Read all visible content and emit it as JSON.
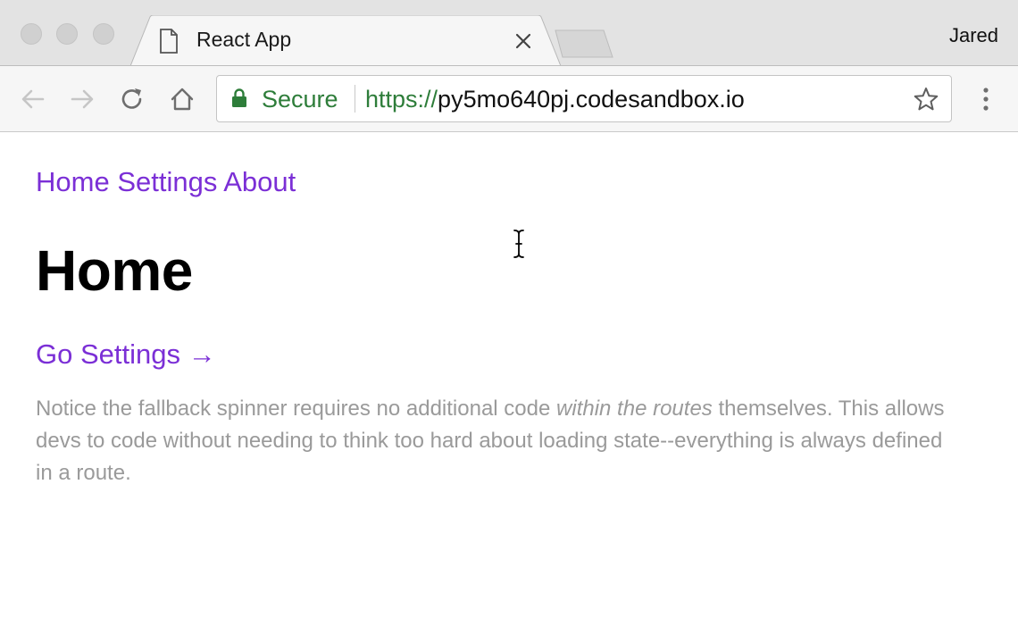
{
  "browser": {
    "tab": {
      "title": "React App"
    },
    "profile_name": "Jared",
    "address_bar": {
      "secure_label": "Secure",
      "url_scheme": "https://",
      "url_host": "py5mo640pj.codesandbox.io"
    },
    "colors": {
      "secure_green": "#2e7d3a",
      "tabstrip": "#e3e3e3"
    }
  },
  "page": {
    "nav": [
      {
        "label": "Home"
      },
      {
        "label": "Settings"
      },
      {
        "label": "About"
      }
    ],
    "heading": "Home",
    "go_link": "Go Settings →",
    "notice": {
      "before": "Notice the fallback spinner requires no additional code ",
      "emphasis": "within the routes",
      "after": " themselves. This allows devs to code without needing to think too hard about loading state--everything is always defined in a route."
    },
    "colors": {
      "link": "#7b2fd6",
      "muted_text": "#9a9a9a"
    }
  }
}
